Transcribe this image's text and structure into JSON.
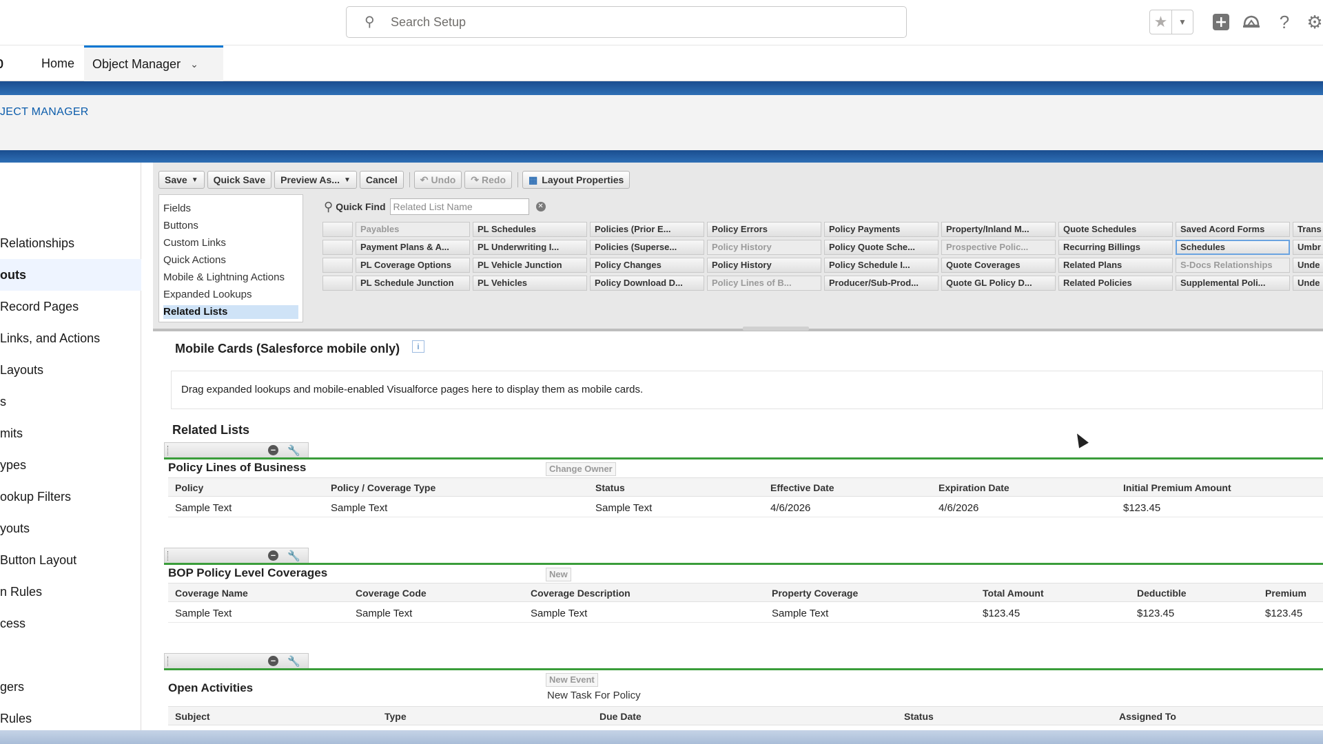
{
  "header": {
    "search_placeholder": "Search Setup",
    "icons": [
      "search-icon",
      "star-icon",
      "chevron-down-icon",
      "add-icon",
      "trailhead-icon",
      "help-icon",
      "gear-icon"
    ]
  },
  "nav": {
    "app_name": "p",
    "tabs": [
      {
        "label": "Home"
      },
      {
        "label": "Object Manager"
      }
    ]
  },
  "breadcrumb": "JECT MANAGER",
  "sidebar": {
    "items": [
      {
        "label": "Relationships"
      },
      {
        "label": "outs"
      },
      {
        "label": "Record Pages"
      },
      {
        "label": "Links, and Actions"
      },
      {
        "label": "Layouts"
      },
      {
        "label": "s"
      },
      {
        "label": "mits"
      },
      {
        "label": "ypes"
      },
      {
        "label": "ookup Filters"
      },
      {
        "label": "youts"
      },
      {
        "label": "Button Layout"
      },
      {
        "label": "n Rules"
      },
      {
        "label": "cess"
      },
      {
        "label": "gers"
      },
      {
        "label": "Rules"
      }
    ]
  },
  "toolbar": {
    "save": "Save",
    "quick_save": "Quick Save",
    "preview_as": "Preview As...",
    "cancel": "Cancel",
    "undo": "Undo",
    "redo": "Redo",
    "layout_properties": "Layout Properties"
  },
  "palette": {
    "categories": [
      "Fields",
      "Buttons",
      "Custom Links",
      "Quick Actions",
      "Mobile & Lightning Actions",
      "Expanded Lookups",
      "Related Lists"
    ],
    "quick_find_label": "Quick Find",
    "quick_find_placeholder": "Related List Name",
    "columns": [
      [
        "Payables",
        "Payment Plans & A...",
        "PL Coverage Options",
        "PL Schedule Junction"
      ],
      [
        "PL Schedules",
        "PL Underwriting I...",
        "PL Vehicle Junction",
        "PL Vehicles"
      ],
      [
        "Policies (Prior E...",
        "Policies (Superse...",
        "Policy Changes",
        "Policy Download D..."
      ],
      [
        "Policy Errors",
        "Policy History",
        "Policy History",
        "Policy Lines of B..."
      ],
      [
        "Policy Payments",
        "Policy Quote Sche...",
        "Policy Schedule I...",
        "Producer/Sub-Prod..."
      ],
      [
        "Property/Inland M...",
        "Prospective Polic...",
        "Quote Coverages",
        "Quote GL Policy D..."
      ],
      [
        "Quote Schedules",
        "Recurring Billings",
        "Related Plans",
        "Related Policies"
      ],
      [
        "Saved Acord Forms",
        "Schedules",
        "S-Docs Relationships",
        "Supplemental Poli..."
      ],
      [
        "Trans",
        "Umbr",
        "Unde",
        "Unde"
      ]
    ]
  },
  "mobile_cards": {
    "title": "Mobile Cards (Salesforce mobile only)",
    "info": "i",
    "text": "Drag expanded lookups and mobile-enabled Visualforce pages here to display them as mobile cards."
  },
  "related_lists": {
    "title": "Related Lists",
    "lists": [
      {
        "name": "Policy Lines of Business",
        "action": "Change Owner",
        "columns": [
          "Policy",
          "Policy / Coverage Type",
          "Status",
          "Effective Date",
          "Expiration Date",
          "Initial Premium Amount"
        ],
        "row": [
          "Sample Text",
          "Sample Text",
          "Sample Text",
          "4/6/2026",
          "4/6/2026",
          "$123.45"
        ]
      },
      {
        "name": "BOP Policy Level Coverages",
        "action": "New",
        "columns": [
          "Coverage Name",
          "Coverage Code",
          "Coverage Description",
          "Property Coverage",
          "Total Amount",
          "Deductible",
          "Premium"
        ],
        "row": [
          "Sample Text",
          "Sample Text",
          "Sample Text",
          "Sample Text",
          "$123.45",
          "$123.45",
          "$123.45"
        ]
      },
      {
        "name": "Open Activities",
        "action": "New Event",
        "action2": "New Task For Policy",
        "columns": [
          "Subject",
          "Type",
          "Due Date",
          "Status",
          "Assigned To"
        ]
      }
    ]
  }
}
